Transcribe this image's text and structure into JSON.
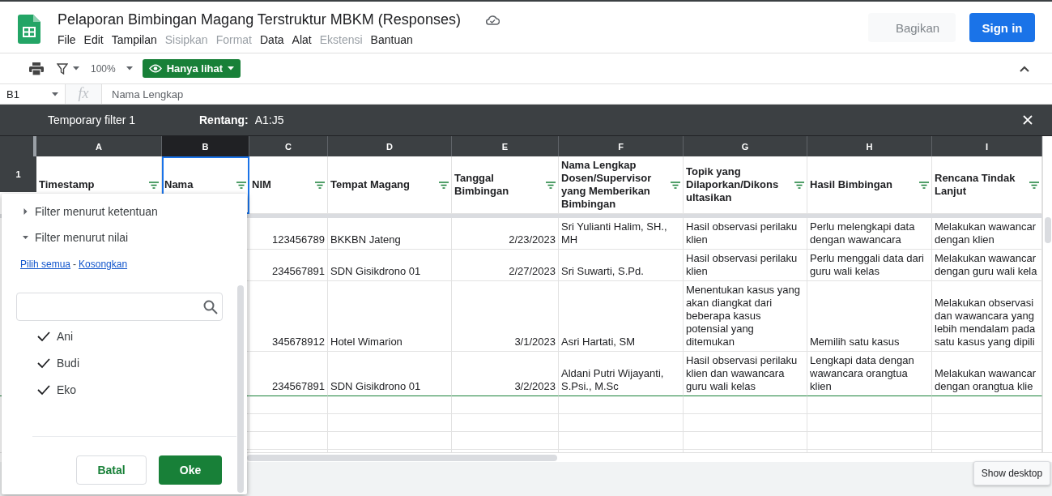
{
  "app": {
    "title": "Pelaporan Bimbingan Magang Terstruktur MBKM (Responses)",
    "menu": [
      {
        "label": "File",
        "disabled": false
      },
      {
        "label": "Edit",
        "disabled": false
      },
      {
        "label": "Tampilan",
        "disabled": false
      },
      {
        "label": "Sisipkan",
        "disabled": true
      },
      {
        "label": "Format",
        "disabled": true
      },
      {
        "label": "Data",
        "disabled": false
      },
      {
        "label": "Alat",
        "disabled": false
      },
      {
        "label": "Ekstensi",
        "disabled": true
      },
      {
        "label": "Bantuan",
        "disabled": false
      }
    ],
    "share_button": {
      "label": "Bagikan",
      "disabled": true
    },
    "sign_in_button": "Sign in"
  },
  "toolbar": {
    "zoom": "100%",
    "mode_button": "Hanya lihat"
  },
  "formula_bar": {
    "cell_ref": "B1",
    "fx": "fx",
    "content": "Nama Lengkap"
  },
  "filter_bar": {
    "name": "Temporary filter 1",
    "range_label": "Rentang:",
    "range": "A1:J5"
  },
  "sheet": {
    "columns": [
      {
        "letter": "A",
        "selected": false,
        "kind": "text"
      },
      {
        "letter": "B",
        "selected": true,
        "kind": "text"
      },
      {
        "letter": "C",
        "selected": false,
        "kind": "number"
      },
      {
        "letter": "D",
        "selected": false,
        "kind": "text"
      },
      {
        "letter": "E",
        "selected": false,
        "kind": "number"
      },
      {
        "letter": "F",
        "selected": false,
        "kind": "text"
      },
      {
        "letter": "G",
        "selected": false,
        "kind": "text"
      },
      {
        "letter": "H",
        "selected": false,
        "kind": "text"
      },
      {
        "letter": "I",
        "selected": false,
        "kind": "text"
      }
    ],
    "header_row": {
      "number": "1",
      "cells": [
        "Timestamp",
        "Nama",
        "NIM",
        "Tempat Magang",
        "Tanggal\nBimbingan",
        "Nama Lengkap\nDosen/Supervisor\nyang Memberikan\nBimbingan",
        "Topik yang\nDilaporkan/Dikons\nultasikan",
        "Hasil Bimbingan",
        "Rencana Tindak\nLanjut"
      ]
    },
    "rows": [
      {
        "cells": [
          "",
          "",
          "123456789",
          "BKKBN Jateng",
          "2/23/2023",
          "Sri Yulianti Halim, SH.,\nMH",
          "Hasil observasi perilaku\nklien",
          "Perlu melengkapi data\ndengan wawancara",
          "Melakukan wawancar\ndengan klien"
        ]
      },
      {
        "cells": [
          "",
          "",
          "234567891",
          "SDN Gisikdrono 01",
          "2/27/2023",
          "Sri Suwarti, S.Pd.",
          "Hasil observasi perilaku\nklien",
          "Perlu menggali data dari\nguru wali kelas",
          "Melakukan wawancar\ndengan guru wali kela"
        ]
      },
      {
        "cells": [
          "",
          "",
          "345678912",
          "Hotel Wimarion",
          "3/1/2023",
          "Asri Hartati, SM",
          "Menentukan kasus yang\nakan diangkat dari\nbeberapa kasus\npotensial yang\nditemukan",
          "Memilih satu kasus",
          "Melakukan observasi\ndan wawancara yang\nlebih mendalam pada\nsatu kasus yang dipili"
        ]
      },
      {
        "cells": [
          "",
          "",
          "234567891",
          "SDN Gisikdrono 01",
          "3/2/2023",
          "Aldani Putri Wijayanti,\nS.Psi., M.Sc",
          "Hasil observasi perilaku\nklien dan wawancara\nguru wali kelas",
          "Lengkapi data dengan\nwawancara orangtua\nklien",
          "Melakukan wawancar\ndengan orangtua klie"
        ]
      }
    ]
  },
  "filter_popup": {
    "sections": [
      {
        "label": "Filter menurut ketentuan",
        "expanded": false
      },
      {
        "label": "Filter menurut nilai",
        "expanded": true
      }
    ],
    "select_all": "Pilih semua",
    "separator": "-",
    "clear": "Kosongkan",
    "values": [
      {
        "label": "Ani",
        "checked": true
      },
      {
        "label": "Budi",
        "checked": true
      },
      {
        "label": "Eko",
        "checked": true
      }
    ],
    "cancel_button": "Batal",
    "ok_button": "Oke"
  },
  "tooltip": "Show desktop"
}
